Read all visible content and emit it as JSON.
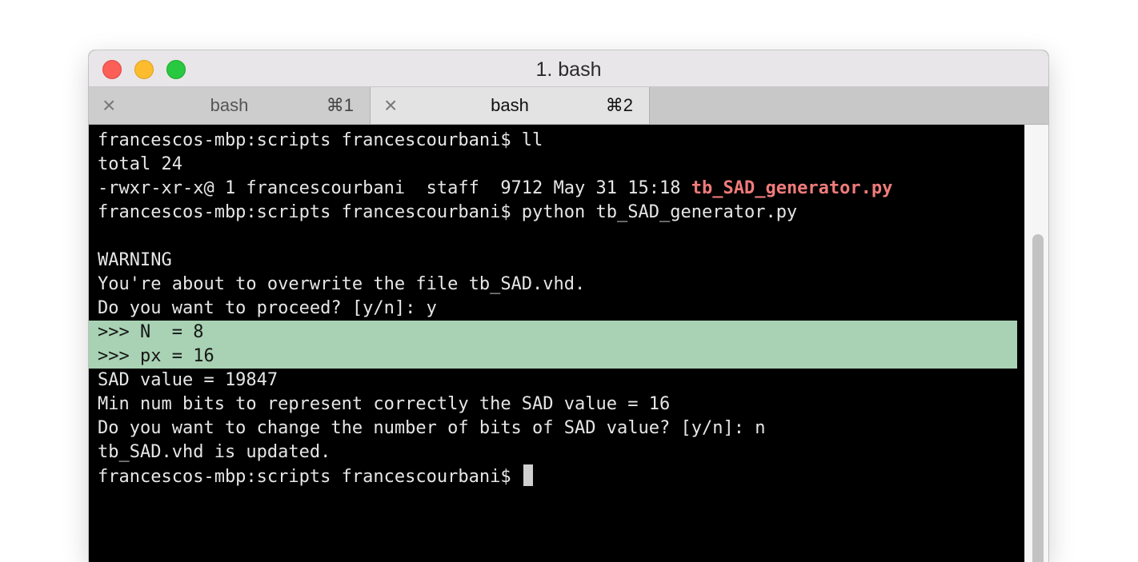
{
  "window": {
    "title": "1. bash"
  },
  "tabs": [
    {
      "label": "bash",
      "shortcut": "⌘1",
      "close_icon": "close-icon",
      "active": false
    },
    {
      "label": "bash",
      "shortcut": "⌘2",
      "close_icon": "close-icon",
      "active": true
    }
  ],
  "terminal": {
    "lines": [
      "francescos-mbp:scripts francescourbani$ ll",
      "total 24",
      "-rwxr-xr-x@ 1 francescourbani  staff  9712 May 31 15:18 ",
      "francescos-mbp:scripts francescourbani$ python tb_SAD_generator.py",
      "",
      "WARNING",
      "You're about to overwrite the file tb_SAD.vhd.",
      "Do you want to proceed? [y/n]: y",
      ">>> N  = 8",
      ">>> px = 16",
      "SAD value = 19847",
      "Min num bits to represent correctly the SAD value = 16",
      "Do you want to change the number of bits of SAD value? [y/n]: n",
      "tb_SAD.vhd is updated.",
      "francescos-mbp:scripts francescourbani$ "
    ],
    "executable_file": "tb_SAD_generator.py",
    "colors": {
      "background": "#000000",
      "text": "#e6e6e6",
      "highlight": "#a8d2b3",
      "executable": "#f07b7b"
    }
  }
}
